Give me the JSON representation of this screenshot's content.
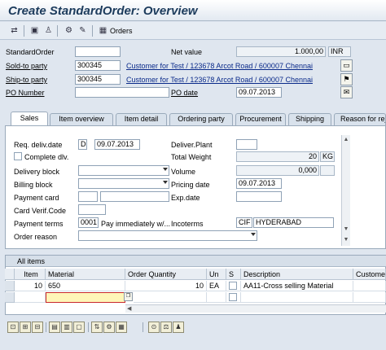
{
  "window": {
    "title": "Create StandardOrder: Overview"
  },
  "toolbar": {
    "orders_label": "Orders"
  },
  "header": {
    "standard_order_label": "StandardOrder",
    "standard_order_value": "",
    "net_value_label": "Net value",
    "net_value": "1.000,00",
    "currency": "INR",
    "sold_to_label": "Sold-to party",
    "sold_to_value": "300345",
    "sold_to_desc": "Customer for Test / 123678 Arcot Road / 600007 Chennai",
    "ship_to_label": "Ship-to party",
    "ship_to_value": "300345",
    "ship_to_desc": "Customer for Test / 123678 Arcot Road / 600007 Chennai",
    "po_number_label": "PO Number",
    "po_number_value": "",
    "po_date_label": "PO date",
    "po_date_value": "09.07.2013"
  },
  "tabs": [
    "Sales",
    "Item overview",
    "Item detail",
    "Ordering party",
    "Procurement",
    "Shipping",
    "Reason for rejection"
  ],
  "sales": {
    "req_deliv_label": "Req. deliv.date",
    "req_deliv_type": "D",
    "req_deliv_value": "09.07.2013",
    "deliver_plant_label": "Deliver.Plant",
    "complete_dlv_label": "Complete dlv.",
    "total_weight_label": "Total Weight",
    "total_weight_value": "20",
    "weight_unit": "KG",
    "delivery_block_label": "Delivery block",
    "volume_label": "Volume",
    "volume_value": "0,000",
    "billing_block_label": "Billing block",
    "pricing_date_label": "Pricing date",
    "pricing_date_value": "09.07.2013",
    "payment_card_label": "Payment card",
    "exp_date_label": "Exp.date",
    "card_verif_label": "Card Verif.Code",
    "payment_terms_label": "Payment terms",
    "payment_terms_code": "0001",
    "payment_terms_desc": "Pay immediately w/...",
    "incoterms_label": "Incoterms",
    "incoterms_code": "CIF",
    "incoterms_place": "HYDERABAD",
    "order_reason_label": "Order reason"
  },
  "items": {
    "section_title": "All items",
    "columns": [
      "Item",
      "Material",
      "Order Quantity",
      "Un",
      "S",
      "Description",
      "Custome"
    ],
    "rows": [
      {
        "item": "10",
        "material": "650",
        "quantity": "10",
        "unit": "EA",
        "description": "AA11-Cross selling Material"
      },
      {
        "item": "",
        "material": "",
        "quantity": "",
        "unit": "",
        "description": ""
      }
    ]
  }
}
